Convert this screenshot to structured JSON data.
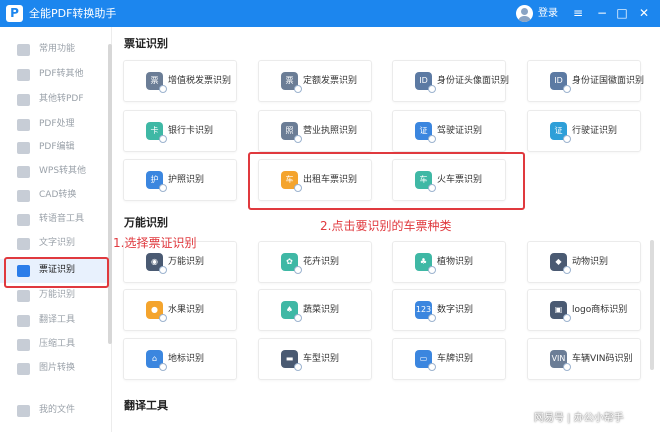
{
  "colors": {
    "brand": "#1c86ee",
    "annotation": "#e0393e",
    "active_icon": "#2b7de9"
  },
  "titlebar": {
    "logo_icon": "pdf-logo-icon",
    "app_title": "全能PDF转换助手",
    "login": "登录",
    "controls": {
      "settings": "≡",
      "minimize": "−",
      "maximize": "□",
      "close": "✕"
    }
  },
  "sidebar": {
    "items": [
      {
        "label": "常用功能",
        "icon": "star-icon",
        "active": false
      },
      {
        "label": "PDF转其他",
        "icon": "pdf-convert-icon",
        "active": false
      },
      {
        "label": "其他转PDF",
        "icon": "to-pdf-icon",
        "active": false
      },
      {
        "label": "PDF处理",
        "icon": "pdf-process-icon",
        "active": false
      },
      {
        "label": "PDF编辑",
        "icon": "pdf-edit-icon",
        "active": false
      },
      {
        "label": "WPS转其他",
        "icon": "wps-icon",
        "active": false
      },
      {
        "label": "CAD转换",
        "icon": "cad-icon",
        "active": false
      },
      {
        "label": "转语音工具",
        "icon": "voice-icon",
        "active": false
      },
      {
        "label": "文字识别",
        "icon": "ocr-icon",
        "active": false
      },
      {
        "label": "票证识别",
        "icon": "ticket-icon",
        "active": true
      },
      {
        "label": "万能识别",
        "icon": "universal-icon",
        "active": false
      },
      {
        "label": "翻译工具",
        "icon": "translate-icon",
        "active": false
      },
      {
        "label": "压缩工具",
        "icon": "compress-icon",
        "active": false
      },
      {
        "label": "图片转换",
        "icon": "image-icon",
        "active": false
      },
      {
        "label": "我的文件",
        "icon": "folder-icon",
        "active": false
      }
    ]
  },
  "annotations": {
    "step1": "1.选择票证识别",
    "step2": "2.点击要识别的车票种类"
  },
  "sections": {
    "ticket": "票证识别",
    "universal": "万能识别",
    "translate": "翻译工具"
  },
  "ticket_cards": [
    {
      "label": "增值税发票识别",
      "icon": "invoice-icon",
      "glyph": "票",
      "color": "#6b7d96"
    },
    {
      "label": "定额发票识别",
      "icon": "fixed-invoice-icon",
      "glyph": "票",
      "color": "#6b7d96"
    },
    {
      "label": "身份证头像面识别",
      "icon": "id-front-icon",
      "glyph": "ID",
      "color": "#5c7aa3"
    },
    {
      "label": "身份证国徽面识别",
      "icon": "id-back-icon",
      "glyph": "ID",
      "color": "#5c7aa3"
    },
    {
      "label": "银行卡识别",
      "icon": "bank-card-icon",
      "glyph": "卡",
      "color": "#3fb8a5"
    },
    {
      "label": "营业执照识别",
      "icon": "license-icon",
      "glyph": "照",
      "color": "#6b7d96"
    },
    {
      "label": "驾驶证识别",
      "icon": "driver-license-icon",
      "glyph": "证",
      "color": "#3b86df"
    },
    {
      "label": "行驶证识别",
      "icon": "vehicle-license-icon",
      "glyph": "证",
      "color": "#2e9fd8"
    },
    {
      "label": "护照识别",
      "icon": "passport-icon",
      "glyph": "护",
      "color": "#3b86df"
    },
    {
      "label": "出租车票识别",
      "icon": "taxi-icon",
      "glyph": "车",
      "color": "#f4a42d"
    },
    {
      "label": "火车票识别",
      "icon": "train-icon",
      "glyph": "车",
      "color": "#3fb8a5"
    }
  ],
  "universal_cards": [
    {
      "label": "万能识别",
      "icon": "eye-icon",
      "glyph": "◉",
      "color": "#4a5a72"
    },
    {
      "label": "花卉识别",
      "icon": "flower-icon",
      "glyph": "✿",
      "color": "#3fb8a5"
    },
    {
      "label": "植物识别",
      "icon": "plant-icon",
      "glyph": "♣",
      "color": "#3fb8a5"
    },
    {
      "label": "动物识别",
      "icon": "animal-icon",
      "glyph": "◆",
      "color": "#4a5a72"
    },
    {
      "label": "水果识别",
      "icon": "fruit-icon",
      "glyph": "●",
      "color": "#f4a42d"
    },
    {
      "label": "蔬菜识别",
      "icon": "vegetable-icon",
      "glyph": "♠",
      "color": "#3fb8a5"
    },
    {
      "label": "数字识别",
      "icon": "number-icon",
      "glyph": "123",
      "color": "#3b86df"
    },
    {
      "label": "logo商标识别",
      "icon": "logo-trademark-icon",
      "glyph": "▣",
      "color": "#4a5a72"
    },
    {
      "label": "地标识别",
      "icon": "landmark-icon",
      "glyph": "⌂",
      "color": "#3b86df"
    },
    {
      "label": "车型识别",
      "icon": "car-model-icon",
      "glyph": "▬",
      "color": "#4a5a72"
    },
    {
      "label": "车牌识别",
      "icon": "plate-icon",
      "glyph": "▭",
      "color": "#3b86df"
    },
    {
      "label": "车辆VIN码识别",
      "icon": "vin-icon",
      "glyph": "VIN",
      "color": "#6b7d96"
    }
  ],
  "watermark": "网易号 | 办公小帮手"
}
